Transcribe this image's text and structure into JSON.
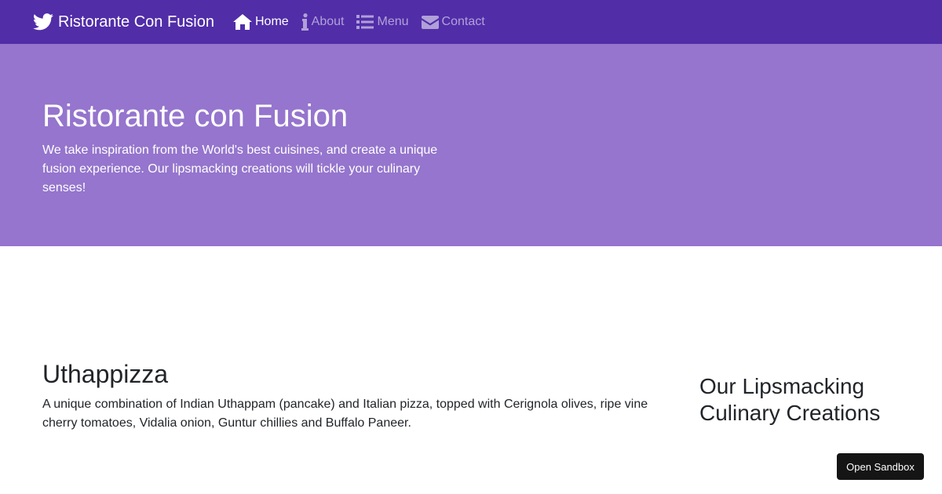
{
  "navbar": {
    "brand": "Ristorante Con Fusion",
    "brand_icon": "twitter-bird-icon",
    "items": [
      {
        "label": "Home",
        "icon": "home-icon",
        "active": true
      },
      {
        "label": "About",
        "icon": "info-icon",
        "active": false
      },
      {
        "label": "Menu",
        "icon": "list-icon",
        "active": false
      },
      {
        "label": "Contact",
        "icon": "envelope-icon",
        "active": false
      }
    ]
  },
  "jumbotron": {
    "title": "Ristorante con Fusion",
    "text": "We take inspiration from the World's best cuisines, and create a unique fusion experience. Our lipsmacking creations will tickle your culinary senses!"
  },
  "main": {
    "dish_title": "Uthappizza",
    "dish_description": "A unique combination of Indian Uthappam (pancake) and Italian pizza, topped with Cerignola olives, ripe vine cherry tomatoes, Vidalia onion, Guntur chillies and Buffalo Paneer."
  },
  "aside": {
    "heading": "Our Lipsmacking Culinary Creations"
  },
  "sandbox_button": "Open Sandbox",
  "colors": {
    "navbar": "#512DA8",
    "jumbotron": "#9575CD",
    "sandbox": "#151515"
  }
}
